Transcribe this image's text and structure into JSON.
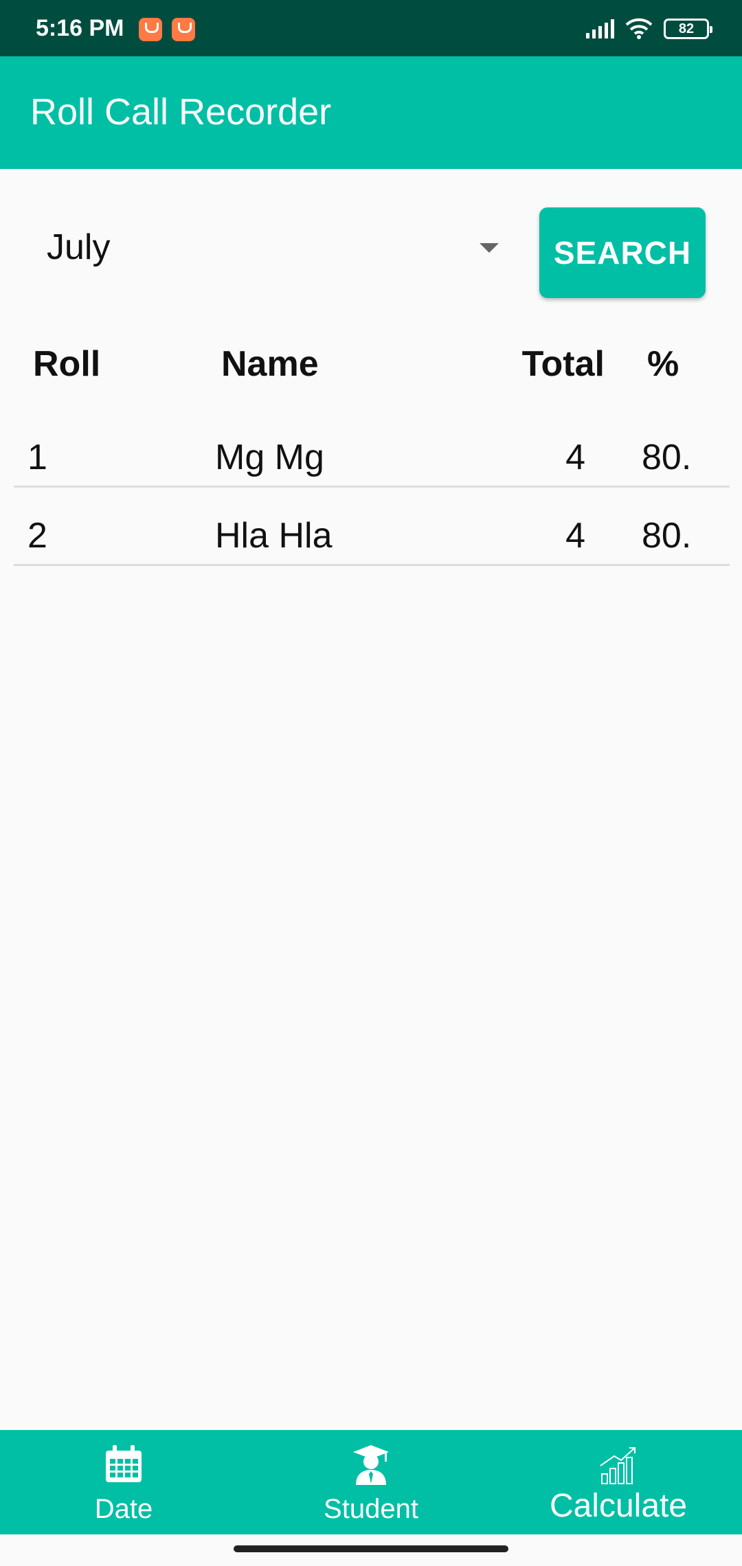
{
  "status_bar": {
    "time": "5:16 PM",
    "battery": "82"
  },
  "app": {
    "title": "Roll Call Recorder"
  },
  "filter": {
    "month": "July",
    "search_label": "SEARCH"
  },
  "table": {
    "headers": {
      "roll": "Roll",
      "name": "Name",
      "total": "Total",
      "percent": "%"
    },
    "rows": [
      {
        "roll": "1",
        "name": "Mg Mg",
        "total": "4",
        "percent": "80."
      },
      {
        "roll": "2",
        "name": "Hla Hla",
        "total": "4",
        "percent": "80."
      }
    ]
  },
  "bottom_nav": {
    "items": [
      {
        "label": "Date",
        "icon": "calendar-icon"
      },
      {
        "label": "Student",
        "icon": "student-icon"
      },
      {
        "label": "Calculate",
        "icon": "chart-icon"
      }
    ]
  },
  "colors": {
    "primary": "#00bfa5",
    "status_bar": "#004d40"
  }
}
